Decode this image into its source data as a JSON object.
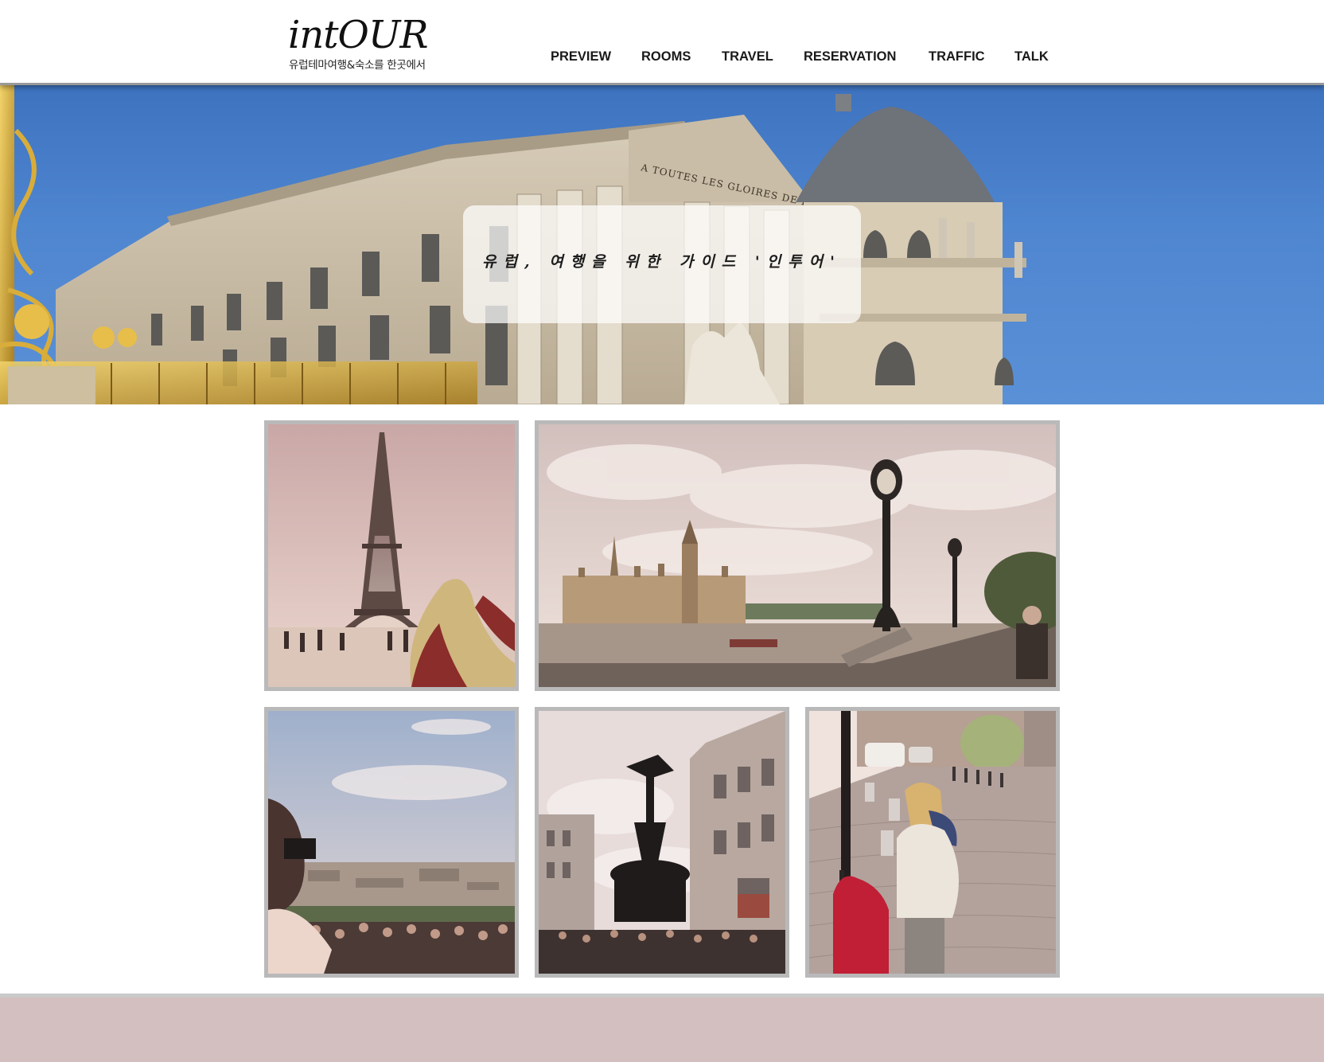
{
  "brand": {
    "logo_text": "intOUR",
    "tagline": "유럽테마여행&숙소를 한곳에서"
  },
  "nav": {
    "items": [
      {
        "label": "PREVIEW"
      },
      {
        "label": "ROOMS"
      },
      {
        "label": "TRAVEL"
      },
      {
        "label": "RESERVATION"
      },
      {
        "label": "TRAFFIC"
      },
      {
        "label": "TALK"
      }
    ]
  },
  "hero": {
    "caption": "유럽, 여행을 위한 가이드 '인투어'",
    "inscription": "A TOUTES LES GLOIRES DE LA FRANCE"
  },
  "gallery": {
    "photos": [
      {
        "subject": "eiffel-tower"
      },
      {
        "subject": "westminster-thames"
      },
      {
        "subject": "montmartre-view"
      },
      {
        "subject": "piccadilly-eros"
      },
      {
        "subject": "cobblestone-street-girl"
      }
    ]
  },
  "colors": {
    "footer_bg": "#d3bfbf",
    "photo_border": "#b9b9b9",
    "nav_text": "#1a1a1a",
    "sky_blue": "#4f86d0"
  }
}
